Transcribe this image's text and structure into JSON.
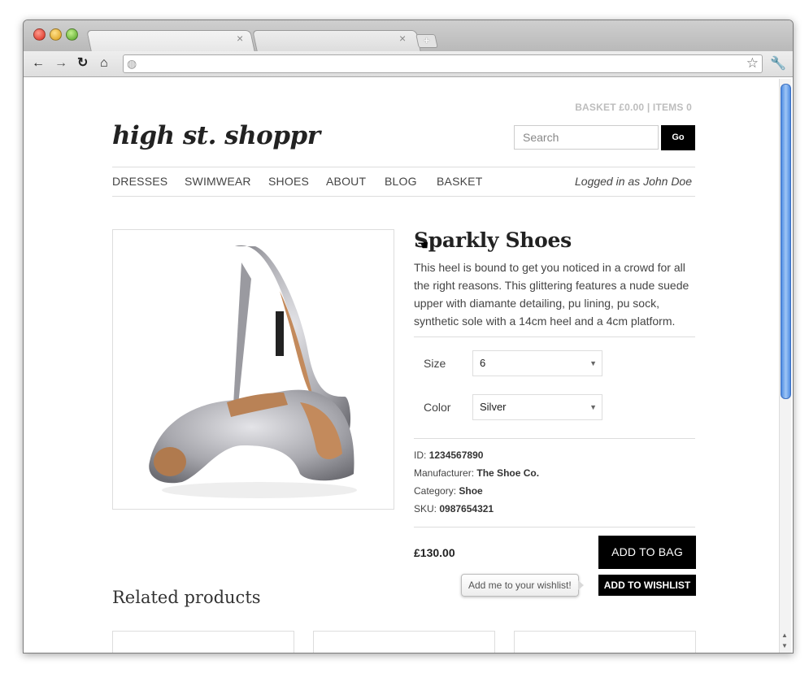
{
  "browser": {
    "new_tab_label": "+",
    "omnibox": {
      "value": ""
    }
  },
  "page": {
    "basket_summary": "BASKET £0.00 | ITEMS 0",
    "logo": "high st. shoppr",
    "search": {
      "placeholder": "Search",
      "button_label": "Go"
    },
    "nav": {
      "items": [
        "DRESSES",
        "SWIMWEAR",
        "SHOES",
        "ABOUT",
        "BLOG",
        "BASKET"
      ]
    },
    "logged_in": "Logged in as John Doe",
    "product": {
      "title": "Sparkly Shoes",
      "description": "This heel is bound to get you noticed in a crowd for all the right reasons. This glittering features a nude suede upper with diamante detailing, pu lining, pu sock, synthetic sole with a 14cm heel and a 4cm platform.",
      "size_label": "Size",
      "size_value": "6",
      "color_label": "Color",
      "color_value": "Silver",
      "id_label": "ID:",
      "id_value": "1234567890",
      "manufacturer_label": "Manufacturer:",
      "manufacturer_value": "The Shoe Co.",
      "category_label": "Category:",
      "category_value": "Shoe",
      "sku_label": "SKU:",
      "sku_value": "0987654321",
      "price": "£130.00",
      "add_to_bag": "ADD TO BAG",
      "add_to_wishlist": "ADD TO WISHLIST",
      "wishlist_tooltip": "Add me to your wishlist!"
    },
    "related_title": "Related products"
  },
  "colors": {
    "accent": "#000000",
    "text": "#444444",
    "muted": "#bdbdbd",
    "scroll_thumb": "#4d8be3"
  }
}
